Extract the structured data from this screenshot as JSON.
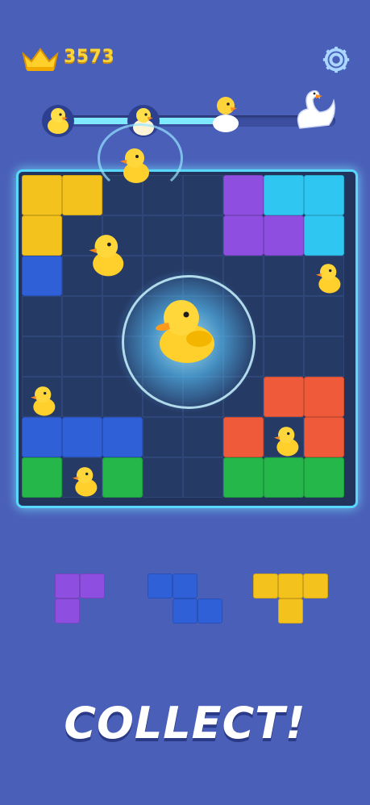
{
  "header": {
    "score": "3573",
    "crown_icon": "crown-icon",
    "settings_icon": "gear-icon"
  },
  "progress": {
    "value": 0.64,
    "milestones": [
      "duckling-icon",
      "duckling-icon",
      "duck-icon",
      "swan-icon"
    ]
  },
  "board": {
    "rows": 8,
    "cols": 8
  },
  "tray": {
    "pieces": [
      "purple",
      "blue",
      "yellow"
    ]
  },
  "colors": {
    "yellow": "#f4c21c",
    "purple": "#8e4fe0",
    "cyan": "#2fc7f2",
    "blue": "#2f60d8",
    "green": "#25b74a",
    "red": "#ee5a3a",
    "background": "#4a5fb8",
    "board": "#22335c",
    "board_border": "#58d8ff"
  },
  "caption": "COLLECT!"
}
